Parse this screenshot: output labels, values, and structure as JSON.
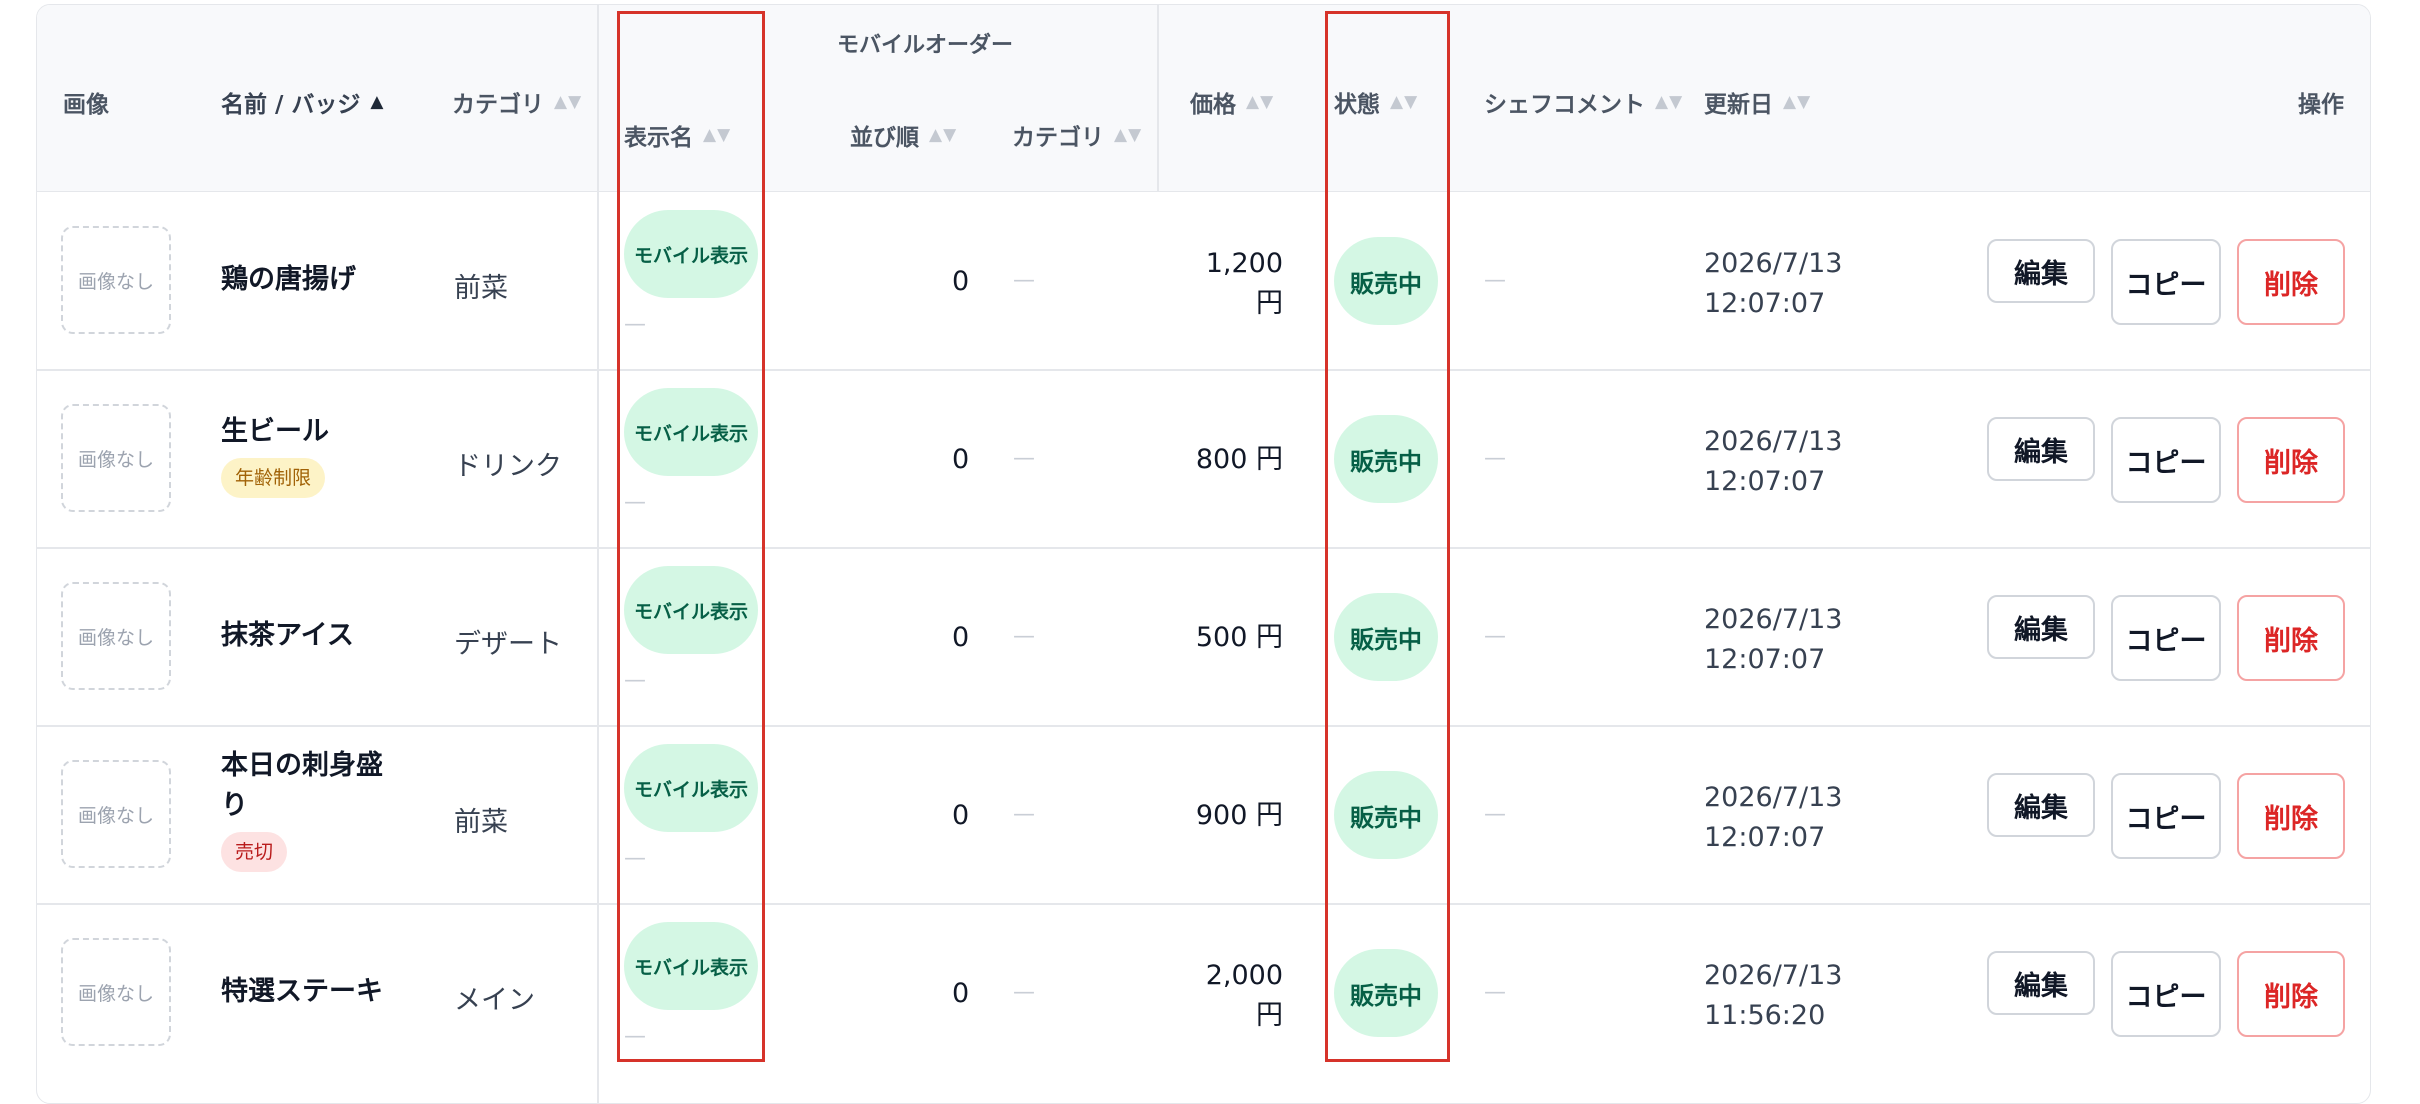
{
  "header": {
    "image": "画像",
    "name_badge": "名前 / バッジ",
    "category": "カテゴリ",
    "mobile_order_group": "モバイルオーダー",
    "display_name": "表示名",
    "sort_order": "並び順",
    "mobile_category": "カテゴリ",
    "price": "価格",
    "status": "状態",
    "chef_comment": "シェフコメント",
    "updated": "更新日",
    "actions": "操作",
    "sort_icon": "▲▼",
    "sort_active_icon": "▲"
  },
  "rows": [
    {
      "image": "画像なし",
      "name": "鶏の唐揚げ",
      "badge": "",
      "category": "前菜",
      "mobile": "モバイル表示",
      "mobile_dash": "—",
      "order": "0",
      "mcat": "—",
      "price_line1": "1,200",
      "price_line2": "円",
      "status": "販売中",
      "comment": "—",
      "date": "2026/7/13",
      "time": "12:07:07",
      "edit": "編集",
      "copy": "コピー",
      "delete": "削除"
    },
    {
      "image": "画像なし",
      "name": "生ビール",
      "badge": "年齢制限",
      "category": "ドリンク",
      "mobile": "モバイル表示",
      "mobile_dash": "—",
      "order": "0",
      "mcat": "—",
      "price_line1": "800 円",
      "price_line2": "",
      "status": "販売中",
      "comment": "—",
      "date": "2026/7/13",
      "time": "12:07:07",
      "edit": "編集",
      "copy": "コピー",
      "delete": "削除"
    },
    {
      "image": "画像なし",
      "name": "抹茶アイス",
      "badge": "",
      "category": "デザート",
      "mobile": "モバイル表示",
      "mobile_dash": "—",
      "order": "0",
      "mcat": "—",
      "price_line1": "500 円",
      "price_line2": "",
      "status": "販売中",
      "comment": "—",
      "date": "2026/7/13",
      "time": "12:07:07",
      "edit": "編集",
      "copy": "コピー",
      "delete": "削除"
    },
    {
      "image": "画像なし",
      "name": "本日の刺身盛り",
      "badge": "売切",
      "category": "前菜",
      "mobile": "モバイル表示",
      "mobile_dash": "—",
      "order": "0",
      "mcat": "—",
      "price_line1": "900 円",
      "price_line2": "",
      "status": "販売中",
      "comment": "—",
      "date": "2026/7/13",
      "time": "12:07:07",
      "edit": "編集",
      "copy": "コピー",
      "delete": "削除"
    },
    {
      "image": "画像なし",
      "name": "特選ステーキ",
      "badge": "",
      "category": "メイン",
      "mobile": "モバイル表示",
      "mobile_dash": "—",
      "order": "0",
      "mcat": "—",
      "price_line1": "2,000",
      "price_line2": "円",
      "status": "販売中",
      "comment": "—",
      "date": "2026/7/13",
      "time": "11:56:20",
      "edit": "編集",
      "copy": "コピー",
      "delete": "削除"
    }
  ],
  "colors": {
    "highlight": "#d6332a",
    "pill_bg": "#d4f7e4",
    "delete": "#dc2626"
  }
}
